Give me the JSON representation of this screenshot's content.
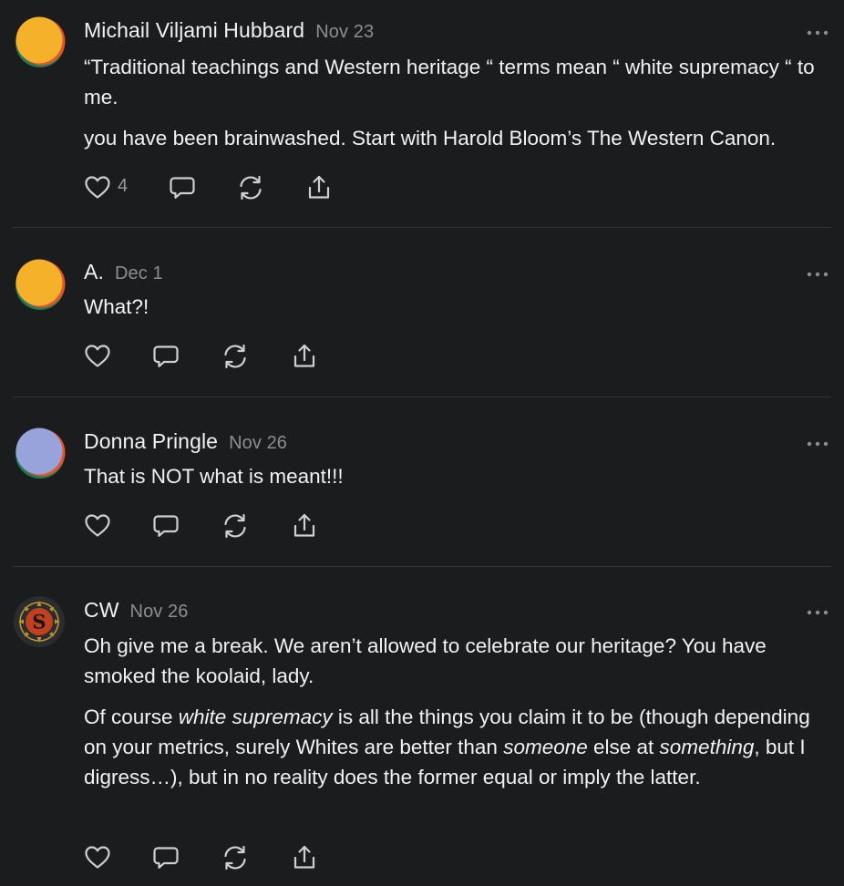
{
  "comments": [
    {
      "author": "Michail Viljami Hubbard",
      "date": "Nov 23",
      "paragraphs": [
        "“Traditional teachings and Western heritage “ terms mean “ white supremacy “ to me.",
        "you have been brainwashed. Start with Harold Bloom’s The Western Canon."
      ],
      "like_count": "4",
      "avatar": "gradient-avatar-orange"
    },
    {
      "author": "A.",
      "date": "Dec 1",
      "paragraphs": [
        "What?!"
      ],
      "avatar": "gradient-avatar-orange"
    },
    {
      "author": "Donna Pringle",
      "date": "Nov 26",
      "paragraphs": [
        "That is NOT what is meant!!!"
      ],
      "avatar": "gradient-avatar-lavender"
    },
    {
      "author": "CW",
      "date": "Nov 26",
      "paragraphs": [
        "Oh give me a break. We aren’t allowed to celebrate our heritage? You have smoked the koolaid, lady."
      ],
      "p2_parts": {
        "a": "Of course ",
        "b": "white supremacy",
        "c": " is all the things you claim it to be (though depending on your metrics, surely Whites are better than ",
        "d": "someone",
        "e": " else at ",
        "f": "something",
        "g": ", but I digress…), but in no reality does the former equal or imply the latter."
      },
      "avatar": "emblem-avatar-s"
    }
  ],
  "icons": {
    "like": "heart-icon",
    "reply": "speech-bubble-icon",
    "restack": "restack-icon",
    "share": "share-icon",
    "more": "ellipsis-icon"
  },
  "colors": {
    "background": "#1b1c1e",
    "text": "#f2f2f2",
    "muted": "#8d8d92",
    "divider": "#333438"
  }
}
